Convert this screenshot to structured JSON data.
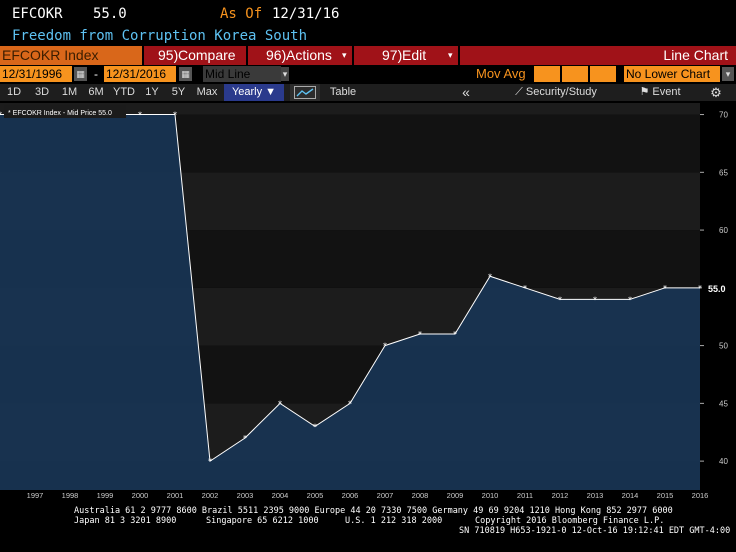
{
  "header": {
    "ticker": "EFCOKR",
    "price": "55.0",
    "as_of_label": "As Of",
    "as_of_date": "12/31/16",
    "description": "Freedom from Corruption Korea South"
  },
  "toolbar": {
    "index_label": "EFCOKR Index",
    "compare_num": "95)",
    "compare_label": "Compare",
    "actions_num": "96)",
    "actions_label": "Actions",
    "edit_num": "97)",
    "edit_label": "Edit",
    "chart_type": "Line Chart"
  },
  "range": {
    "start_date": "12/31/1996",
    "end_date": "12/31/2016",
    "separator": "-",
    "price_type": "Mid Line",
    "mov_avg_label": "Mov Avg",
    "lower_chart": "No Lower Chart"
  },
  "periods": [
    "1D",
    "3D",
    "1M",
    "6M",
    "YTD",
    "1Y",
    "5Y",
    "Max"
  ],
  "frequency": "Yearly ▼",
  "table_label": "Table",
  "back_icon_label": "«",
  "security_study_label": "Security/Study",
  "event_label": "Event",
  "colors": {
    "background": "#000000",
    "area_fill": "#183454",
    "line": "#ffffff",
    "toolbar_red": "#a01218",
    "accent_orange": "#f7931e",
    "title_blue": "#5ec2f2",
    "selected_blue": "#2a3a8c"
  },
  "chart_data": {
    "type": "area",
    "legend": "EFCOKR Index - Mid Price 55.0",
    "last_value_label": "55.0",
    "x": [
      1996,
      1997,
      1998,
      1999,
      2000,
      2001,
      2002,
      2003,
      2004,
      2005,
      2006,
      2007,
      2008,
      2009,
      2010,
      2011,
      2012,
      2013,
      2014,
      2015,
      2016
    ],
    "series": [
      {
        "values": [
          70,
          70,
          70,
          70,
          70,
          70,
          40,
          42,
          45,
          43,
          45,
          50,
          51,
          51,
          56,
          55,
          54,
          54,
          54,
          55,
          55
        ]
      }
    ],
    "x_ticks": [
      "1997",
      "1998",
      "1999",
      "2000",
      "2001",
      "2002",
      "2003",
      "2004",
      "2005",
      "2006",
      "2007",
      "2008",
      "2009",
      "2010",
      "2011",
      "2012",
      "2013",
      "2014",
      "2015",
      "2016"
    ],
    "y_ticks": [
      40,
      45,
      50,
      55,
      60,
      65,
      70
    ],
    "ylim": [
      37.5,
      71
    ],
    "grid": true,
    "legend_position": "top-left"
  },
  "footer": {
    "line1": "Australia 61 2 9777 8600 Brazil 5511 2395 9000 Europe 44 20 7330 7500 Germany 49 69 9204 1210 Hong Kong 852 2977 6000",
    "line2a": "Japan 81 3 3201 8900",
    "line2b": "Singapore 65 6212 1000",
    "line2c": "U.S. 1 212 318 2000",
    "line2d": "Copyright 2016 Bloomberg Finance L.P.",
    "line3": "SN 710819 H653-1921-0 12-Oct-16 19:12:41 EDT  GMT-4:00"
  }
}
